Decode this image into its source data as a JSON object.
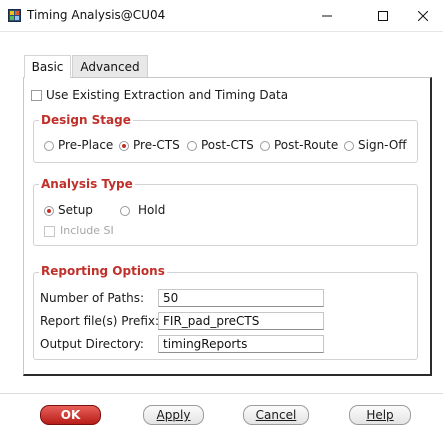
{
  "window": {
    "title": "Timing Analysis@CU04",
    "controls": {
      "minimize": "–",
      "maximize": "☐",
      "close": "✕"
    }
  },
  "tabs": [
    {
      "label": "Basic",
      "active": true
    },
    {
      "label": "Advanced",
      "active": false
    }
  ],
  "use_existing": {
    "label": "Use Existing Extraction and Timing Data",
    "checked": false
  },
  "design_stage": {
    "title": "Design Stage",
    "options": [
      {
        "label": "Pre-Place",
        "selected": false
      },
      {
        "label": "Pre-CTS",
        "selected": true
      },
      {
        "label": "Post-CTS",
        "selected": false
      },
      {
        "label": "Post-Route",
        "selected": false
      },
      {
        "label": "Sign-Off",
        "selected": false
      }
    ]
  },
  "analysis_type": {
    "title": "Analysis Type",
    "options": [
      {
        "label": "Setup",
        "selected": true
      },
      {
        "label": "Hold",
        "selected": false
      }
    ],
    "include_si": {
      "label": "Include SI",
      "checked": false,
      "disabled": true
    }
  },
  "reporting": {
    "title": "Reporting Options",
    "fields": [
      {
        "label": "Number of Paths:",
        "value": "50"
      },
      {
        "label": "Report file(s) Prefix:",
        "value": "FIR_pad_preCTS"
      },
      {
        "label": "Output Directory:",
        "value": "timingReports"
      }
    ]
  },
  "buttons": {
    "ok": "OK",
    "apply": "Apply",
    "cancel": "Cancel",
    "help": "Help"
  },
  "colors": {
    "accent": "#c0302a",
    "ok_button": "#c8302a"
  }
}
